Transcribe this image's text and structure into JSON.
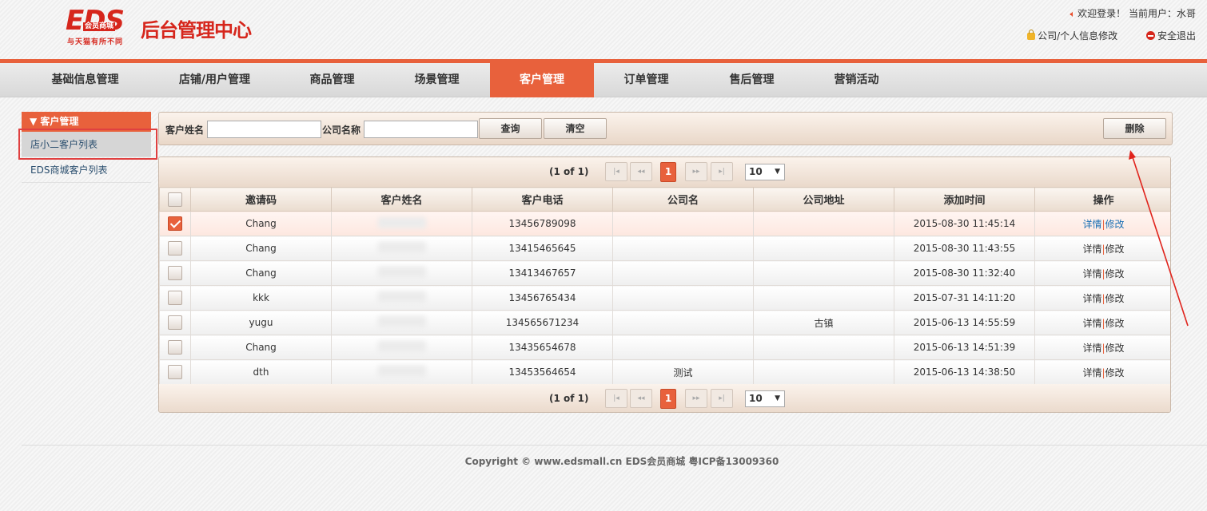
{
  "header": {
    "logo_text": "EDS",
    "logo_badge": "会员商城",
    "logo_slogan": "与天猫有所不同",
    "logo_title": "后台管理中心",
    "welcome": "欢迎登录！ 当前用户：水哥",
    "profile_link": "公司/个人信息修改",
    "logout_link": "安全退出"
  },
  "nav": {
    "items": [
      "基础信息管理",
      "店铺/用户管理",
      "商品管理",
      "场景管理",
      "客户管理",
      "订单管理",
      "售后管理",
      "营销活动"
    ],
    "active": "客户管理"
  },
  "sidebar": {
    "section": "▼ 客户管理",
    "items": [
      "店小二客户列表",
      "EDS商城客户列表"
    ]
  },
  "toolbar": {
    "customer_name_label": "客户姓名",
    "customer_name_value": "",
    "company_name_label": "公司名称",
    "company_name_value": "",
    "query_button": "查询",
    "clear_button": "清空",
    "delete_button": "删除"
  },
  "pager": {
    "info": "(1 of 1)",
    "first": "|◂",
    "prev": "◂◂",
    "current_page": "1",
    "next": "▸▸",
    "last": "▸|",
    "page_size": "10"
  },
  "table": {
    "headers": [
      "邀请码",
      "客户姓名",
      "客户电话",
      "公司名",
      "公司地址",
      "添加时间",
      "操作"
    ],
    "rows": [
      {
        "code": "Chang",
        "name": "",
        "phone": "13456789098",
        "company": "",
        "address": "",
        "time": "2015-08-30 11:45:14",
        "checked": true
      },
      {
        "code": "Chang",
        "name": "",
        "phone": "13415465645",
        "company": "",
        "address": "",
        "time": "2015-08-30 11:43:55",
        "checked": false
      },
      {
        "code": "Chang",
        "name": "",
        "phone": "13413467657",
        "company": "",
        "address": "",
        "time": "2015-08-30 11:32:40",
        "checked": false
      },
      {
        "code": "kkk",
        "name": "",
        "phone": "13456765434",
        "company": "",
        "address": "",
        "time": "2015-07-31 14:11:20",
        "checked": false
      },
      {
        "code": "yugu",
        "name": "",
        "phone": "134565671234",
        "company": "",
        "address": "古镇",
        "time": "2015-06-13 14:55:59",
        "checked": false
      },
      {
        "code": "Chang",
        "name": "",
        "phone": "13435654678",
        "company": "",
        "address": "",
        "time": "2015-06-13 14:51:39",
        "checked": false
      },
      {
        "code": "dth",
        "name": "",
        "phone": "13453564654",
        "company": "测试",
        "address": "",
        "time": "2015-06-13 14:38:50",
        "checked": false
      }
    ],
    "op_detail": "详情",
    "op_sep": "|",
    "op_edit": "修改"
  },
  "footer": {
    "copyright": "Copyright © www.edsmall.cn EDS会员商城 粤ICP备13009360"
  },
  "colors": {
    "accent": "#e8613c",
    "brand_red": "#d6261c"
  }
}
